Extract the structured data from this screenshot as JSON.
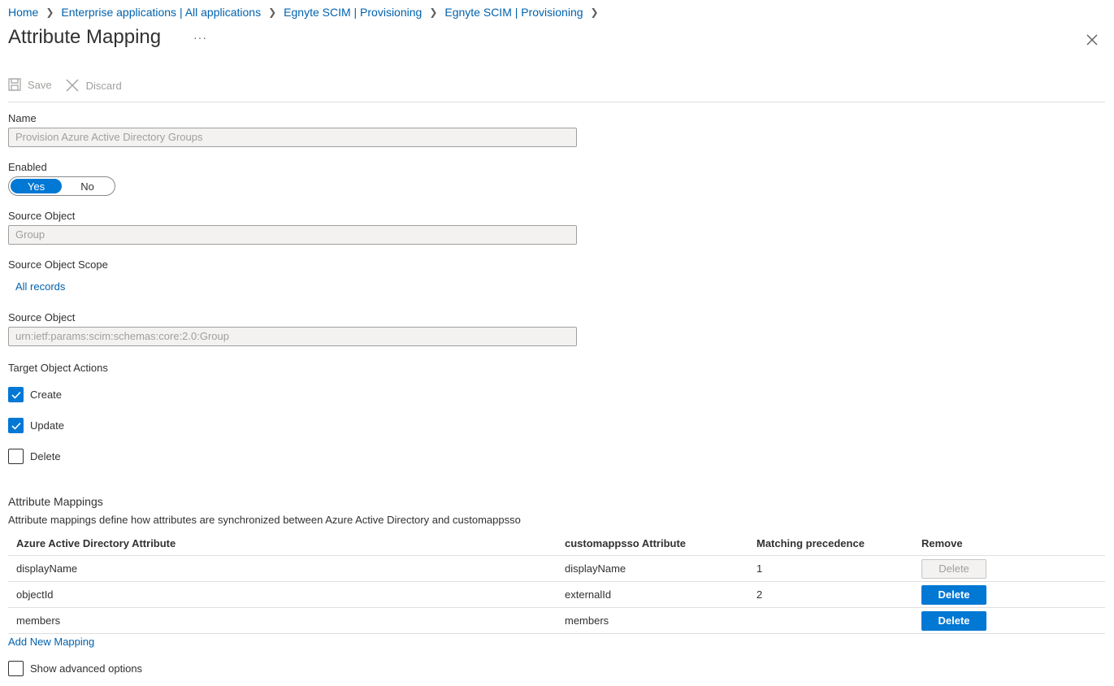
{
  "breadcrumb": [
    "Home",
    "Enterprise applications | All applications",
    "Egnyte SCIM | Provisioning",
    "Egnyte SCIM | Provisioning"
  ],
  "page": {
    "title": "Attribute Mapping",
    "more": "···"
  },
  "toolbar": {
    "save_label": "Save",
    "discard_label": "Discard"
  },
  "form": {
    "name_label": "Name",
    "name_value": "Provision Azure Active Directory Groups",
    "enabled_label": "Enabled",
    "enabled_yes": "Yes",
    "enabled_no": "No",
    "enabled_selected": "Yes",
    "source_object_label": "Source Object",
    "source_object_value": "Group",
    "scope_label": "Source Object Scope",
    "scope_link": "All records",
    "target_object_label": "Source Object",
    "target_object_value": "urn:ietf:params:scim:schemas:core:2.0:Group",
    "actions_label": "Target Object Actions",
    "actions": [
      {
        "label": "Create",
        "checked": true
      },
      {
        "label": "Update",
        "checked": true
      },
      {
        "label": "Delete",
        "checked": false
      }
    ]
  },
  "mappings": {
    "title": "Attribute Mappings",
    "description": "Attribute mappings define how attributes are synchronized between Azure Active Directory and customappsso",
    "columns": [
      "Azure Active Directory Attribute",
      "customappsso Attribute",
      "Matching precedence",
      "Remove"
    ],
    "rows": [
      {
        "source": "displayName",
        "target": "displayName",
        "precedence": "1",
        "delete": "Delete",
        "delete_enabled": false
      },
      {
        "source": "objectId",
        "target": "externalId",
        "precedence": "2",
        "delete": "Delete",
        "delete_enabled": true
      },
      {
        "source": "members",
        "target": "members",
        "precedence": "",
        "delete": "Delete",
        "delete_enabled": true
      }
    ],
    "add_link": "Add New Mapping",
    "advanced_label": "Show advanced options",
    "advanced_checked": false
  },
  "colors": {
    "accent": "#0078d4",
    "link": "#0062ad",
    "disabled_text": "#a19f9d"
  }
}
